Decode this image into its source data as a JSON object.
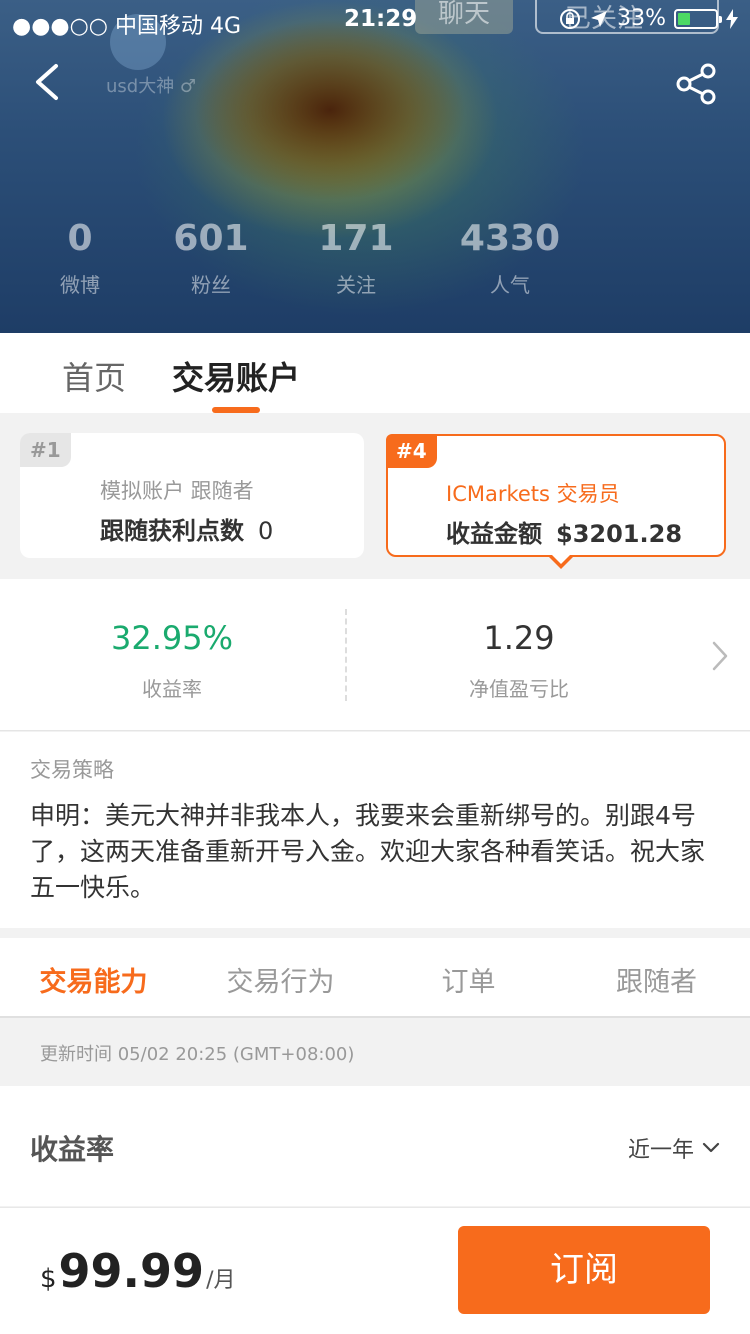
{
  "status_bar": {
    "signal": "●●●○○ 中国移动  4G",
    "time": "21:29",
    "battery": "33%",
    "battery_level": 0.33
  },
  "header": {
    "chat_label": "聊天",
    "follow_label": "已关注",
    "username": "usd大神 ♂",
    "stats": [
      {
        "value": "0",
        "label": "微博"
      },
      {
        "value": "601",
        "label": "粉丝"
      },
      {
        "value": "171",
        "label": "关注"
      },
      {
        "value": "4330",
        "label": "人气"
      }
    ]
  },
  "top_tabs": [
    {
      "label": "首页"
    },
    {
      "label": "交易账户"
    }
  ],
  "accounts": [
    {
      "badge": "#1",
      "line1": "模拟账户  跟随者",
      "line2_label": "跟随获利点数",
      "line2_value": "0"
    },
    {
      "badge": "#4",
      "line1": "ICMarkets  交易员",
      "line2_label": "收益金额",
      "line2_value": "$3201.28"
    }
  ],
  "metrics": [
    {
      "value": "32.95%",
      "label": "收益率"
    },
    {
      "value": "1.29",
      "label": "净值盈亏比"
    }
  ],
  "strategy": {
    "title": "交易策略",
    "text": "申明：美元大神并非我本人，我要来会重新绑号的。别跟4号了，这两天准备重新开号入金。欢迎大家各种看笑话。祝大家五一快乐。"
  },
  "sub_tabs": [
    {
      "label": "交易能力"
    },
    {
      "label": "交易行为"
    },
    {
      "label": "订单"
    },
    {
      "label": "跟随者"
    }
  ],
  "updated": "更新时间 05/02 20:25 (GMT+08:00)",
  "yield_section": {
    "title": "收益率",
    "range": "近一年"
  },
  "footer": {
    "currency": "$",
    "price": "99.99",
    "unit": "/月",
    "subscribe_label": "订阅"
  },
  "colors": {
    "accent": "#f76b1c",
    "positive": "#1aaa6e"
  }
}
